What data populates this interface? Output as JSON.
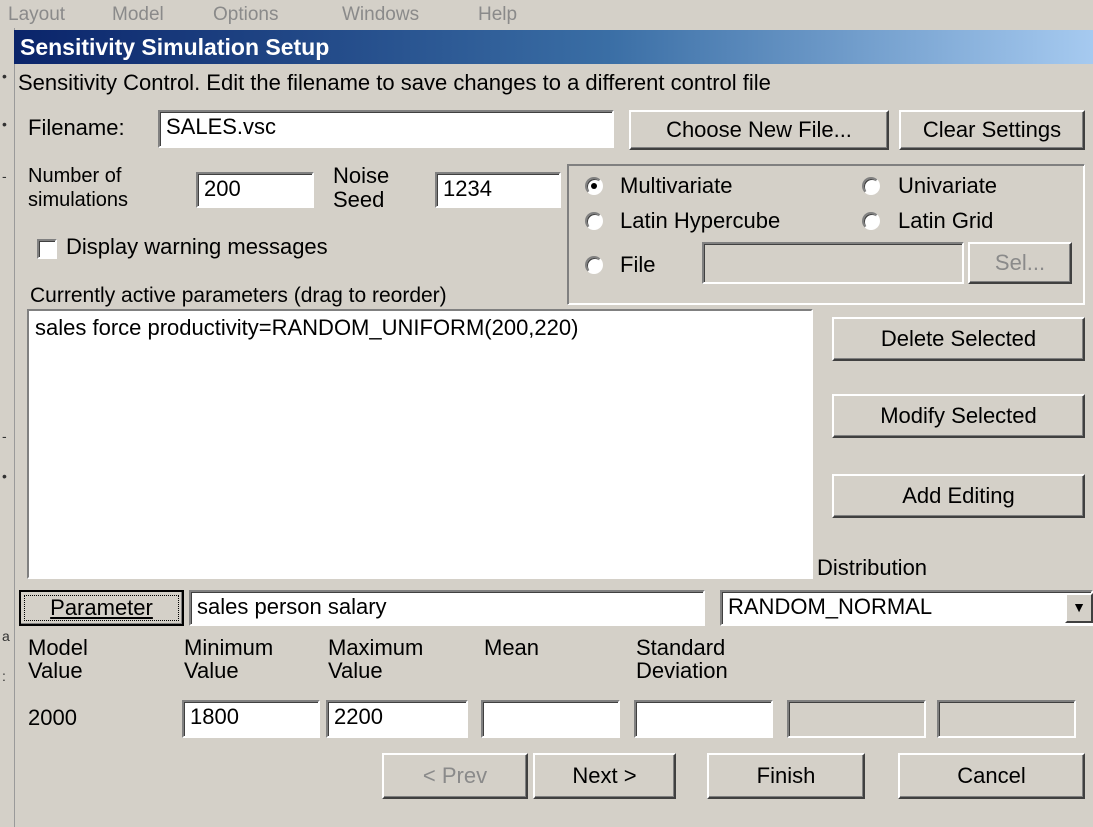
{
  "menubar": [
    "Layout",
    "Model",
    "Options",
    "Windows",
    "Help"
  ],
  "dialog": {
    "title": "Sensitivity Simulation Setup",
    "instruction": "Sensitivity Control.  Edit the filename to save changes to a different control file",
    "filename_label": "Filename:",
    "filename_value": "SALES.vsc",
    "choose_new_file": "Choose New File...",
    "clear_settings": "Clear Settings",
    "num_sim_label_1": "Number of",
    "num_sim_label_2": "simulations",
    "num_sim_value": "200",
    "noise_label_1": "Noise",
    "noise_label_2": "Seed",
    "noise_value": "1234",
    "display_warnings": "Display warning messages",
    "display_warnings_checked": false,
    "methods": {
      "multivariate": "Multivariate",
      "univariate": "Univariate",
      "latin_hypercube": "Latin Hypercube",
      "latin_grid": "Latin Grid",
      "file": "File",
      "selected": "Multivariate"
    },
    "file_value": "",
    "sel_button": "Sel...",
    "active_params_label": "Currently active parameters (drag to reorder)",
    "active_params": [
      "sales force productivity=RANDOM_UNIFORM(200,220)"
    ],
    "delete_selected": "Delete Selected",
    "modify_selected": "Modify Selected",
    "add_editing": "Add Editing",
    "distribution_label": "Distribution",
    "parameter_button": "Parameter",
    "parameter_value": "sales person salary",
    "distribution_value": "RANDOM_NORMAL",
    "columns": {
      "model_1": "Model",
      "model_2": "Value",
      "min_1": "Minimum",
      "min_2": "Value",
      "max_1": "Maximum",
      "max_2": "Value",
      "mean": "Mean",
      "sd_1": "Standard",
      "sd_2": "Deviation"
    },
    "model_value": "2000",
    "min_value": "1800",
    "max_value": "2200",
    "mean_value": "",
    "sd_value": "",
    "prev": "< Prev",
    "next": "Next >",
    "finish": "Finish",
    "cancel": "Cancel"
  }
}
